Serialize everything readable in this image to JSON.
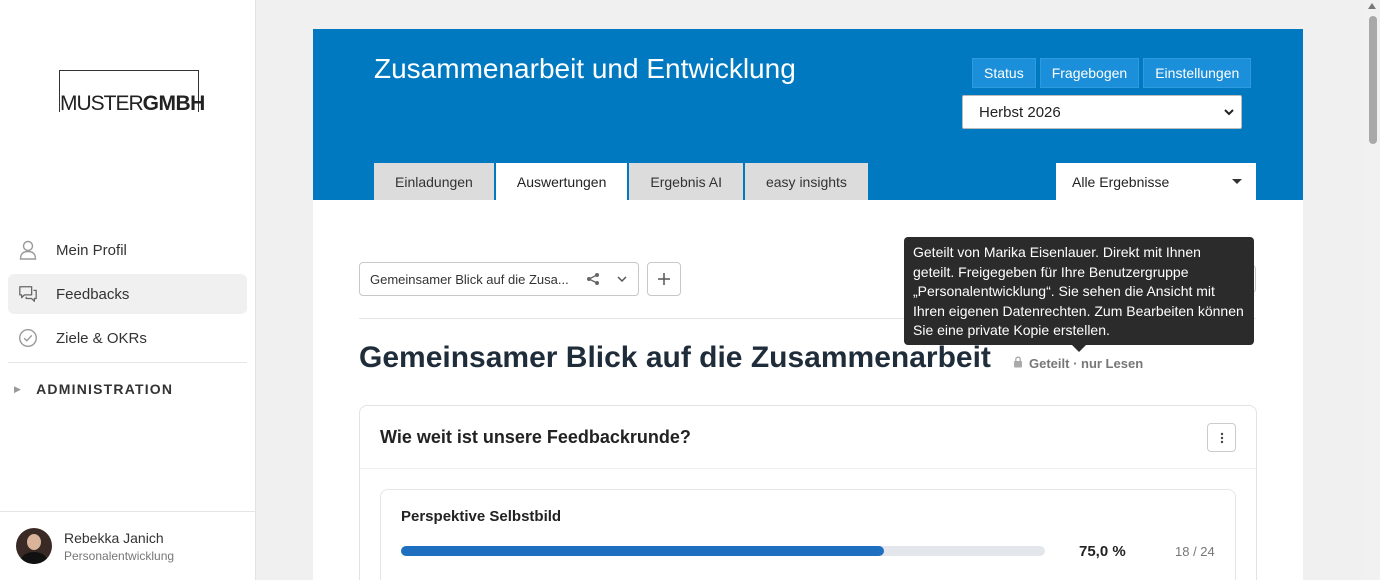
{
  "sidebar": {
    "logo": {
      "part1": "MUSTER",
      "part2": "GMBH"
    },
    "nav": [
      {
        "label": "Mein Profil",
        "icon": "user-icon"
      },
      {
        "label": "Feedbacks",
        "icon": "chat-bubbles-icon"
      },
      {
        "label": "Ziele & OKRs",
        "icon": "check-circle-icon"
      }
    ],
    "admin_label": "ADMINISTRATION",
    "user": {
      "name": "Rebekka Janich",
      "role": "Personalentwicklung"
    }
  },
  "header": {
    "title": "Zusammenarbeit und Entwicklung",
    "buttons": [
      "Status",
      "Fragebogen",
      "Einstellungen"
    ],
    "season": "Herbst 2026",
    "tabs": [
      "Einladungen",
      "Auswertungen",
      "Ergebnis AI",
      "easy insights"
    ],
    "active_tab": "Auswertungen",
    "filter": "Alle Ergebnisse"
  },
  "view": {
    "selector_label": "Gemeinsamer Blick auf die Zusa...",
    "title": "Gemeinsamer Blick auf die Zusammenarbeit",
    "shared_label": "Geteilt · nur Lesen",
    "tooltip": "Geteilt von Marika Eisenlauer. Direkt mit Ihnen geteilt. Freigegeben für Ihre Benutzergruppe „Personalentwicklung“. Sie sehen die Ansicht mit Ihren eigenen Datenrechten. Zum Bearbeiten können Sie eine private Kopie erstellen."
  },
  "card": {
    "title": "Wie weit ist unsere Feedbackrunde?",
    "item": {
      "label": "Perspektive Selbstbild",
      "percent_text": "75,0 %",
      "progress": 0.75,
      "count": "18 / 24"
    }
  },
  "colors": {
    "brand": "#0079c1",
    "progress": "#1f6fc0"
  }
}
